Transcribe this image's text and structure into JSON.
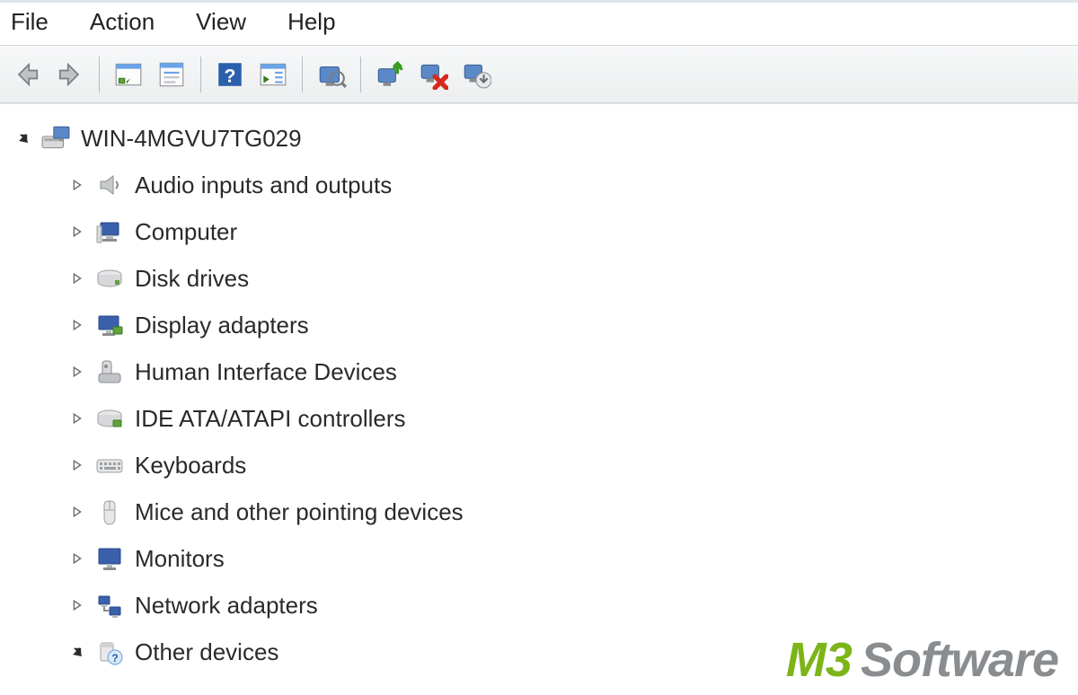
{
  "menu": {
    "file": "File",
    "action": "Action",
    "view": "View",
    "help": "Help"
  },
  "tree": {
    "root": {
      "label": "WIN-4MGVU7TG029",
      "expanded": true
    },
    "items": [
      {
        "label": "Audio inputs and outputs",
        "icon": "speaker",
        "expanded": false
      },
      {
        "label": "Computer",
        "icon": "computer",
        "expanded": false
      },
      {
        "label": "Disk drives",
        "icon": "disk",
        "expanded": false
      },
      {
        "label": "Display adapters",
        "icon": "display",
        "expanded": false
      },
      {
        "label": "Human Interface Devices",
        "icon": "hid",
        "expanded": false
      },
      {
        "label": "IDE ATA/ATAPI controllers",
        "icon": "ide",
        "expanded": false
      },
      {
        "label": "Keyboards",
        "icon": "keyboard",
        "expanded": false
      },
      {
        "label": "Mice and other pointing devices",
        "icon": "mouse",
        "expanded": false
      },
      {
        "label": "Monitors",
        "icon": "monitor",
        "expanded": false
      },
      {
        "label": "Network adapters",
        "icon": "network",
        "expanded": false
      },
      {
        "label": "Other devices",
        "icon": "other",
        "expanded": true
      }
    ]
  },
  "watermark": {
    "prefix": "M3",
    "suffix": "Software"
  }
}
